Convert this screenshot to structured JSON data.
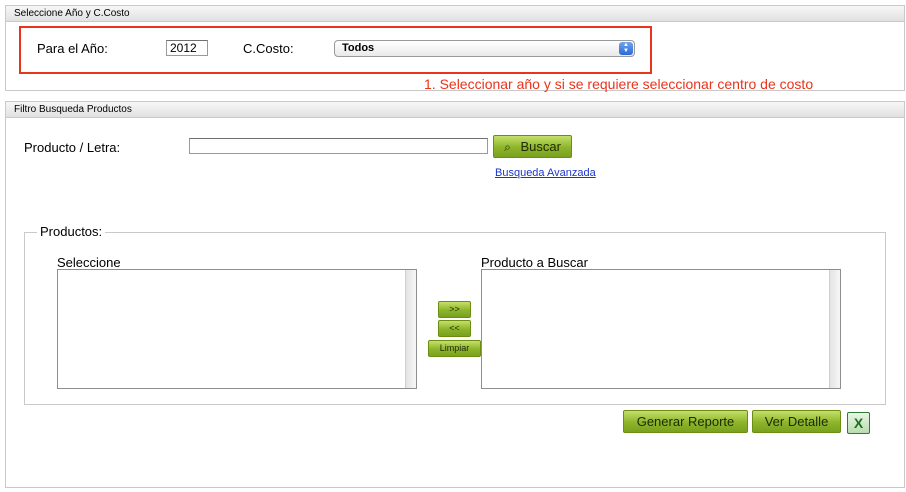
{
  "panel1": {
    "title": "Seleccione Año y C.Costo",
    "year_label": "Para el Año:",
    "year_value": "2012",
    "cost_label": "C.Costo:",
    "cost_selected": "Todos",
    "note": "1. Seleccionar año y si se requiere seleccionar centro de costo",
    "highlight_color": "#e8341c"
  },
  "panel2": {
    "title": "Filtro Busqueda Productos",
    "product_label": "Producto / Letra:",
    "product_value": "",
    "search_button": "Buscar",
    "advanced_link": "Busqueda Avanzada",
    "fieldset_legend": "Productos:",
    "left_list_label": "Seleccione",
    "right_list_label": "Producto a Buscar",
    "add_button": ">>",
    "remove_button": "<<",
    "clear_button": "Limpiar"
  },
  "actions": {
    "report_button": "Generar Reporte",
    "detail_button": "Ver Detalle",
    "excel_icon": "X"
  },
  "icons": {
    "search": "magnifier-icon",
    "excel": "excel-icon"
  },
  "colors": {
    "button_green": "#8db42a",
    "link_blue": "#1a35c9"
  }
}
